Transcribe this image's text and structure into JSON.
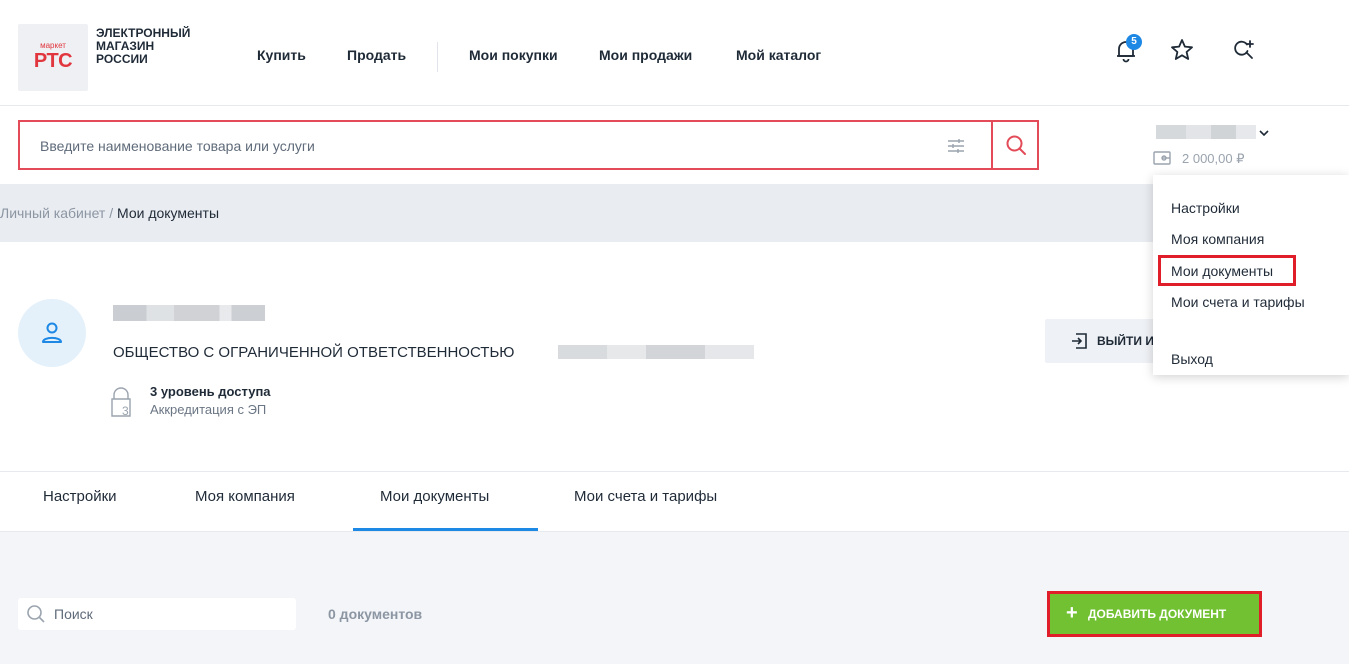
{
  "logo": {
    "small": "маркет",
    "big": "РТС",
    "lines": [
      "ЭЛЕКТРОННЫЙ",
      "МАГАЗИН",
      "РОССИИ"
    ]
  },
  "nav": {
    "buy": "Купить",
    "sell": "Продать",
    "purchases": "Мои покупки",
    "sales": "Мои продажи",
    "catalog": "Мой каталог"
  },
  "header": {
    "notifications_count": "5"
  },
  "search": {
    "placeholder": "Введите наименование товара или услуги"
  },
  "account": {
    "balance": "2 000,00 ₽"
  },
  "breadcrumb": {
    "root": "Личный кабинет / ",
    "current": "Мои документы"
  },
  "profile": {
    "org": "ОБЩЕСТВО С ОГРАНИЧЕННОЙ ОТВЕТСТВЕННОСТЬЮ",
    "level_digit": "3",
    "level": "3 уровень доступа",
    "accreditation": "Аккредитация с ЭП",
    "exit_label": "ВЫЙТИ И"
  },
  "dropdown": {
    "items": [
      "Настройки",
      "Моя компания",
      "Мои документы",
      "Мои счета и тарифы",
      "Выход"
    ],
    "highlighted": "Мои документы"
  },
  "tabs": {
    "items": [
      "Настройки",
      "Моя компания",
      "Мои документы",
      "Мои счета и тарифы"
    ],
    "active": "Мои документы"
  },
  "docs": {
    "search_placeholder": "Поиск",
    "count": "0 документов",
    "add_plus": "+",
    "add_label": "ДОБАВИТЬ ДОКУМЕНТ"
  },
  "colors": {
    "brand_red": "#e2363f",
    "accent_blue": "#1e88e5",
    "add_green": "#71c132",
    "highlight_red": "#e01e2a"
  }
}
